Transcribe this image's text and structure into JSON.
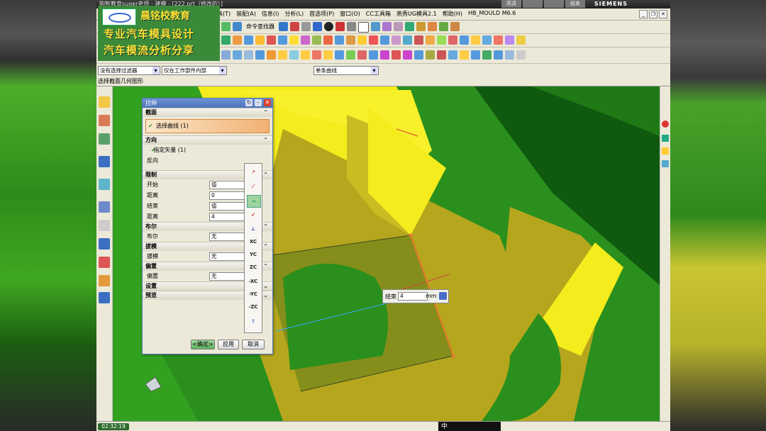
{
  "window": {
    "title": "购智教育suger老师 - 建模 - [222.prt（修改的）]",
    "brand": "SIEMENS",
    "window_buttons": [
      "高清",
      "",
      "",
      "结束"
    ]
  },
  "logo": {
    "line1": "晨铭校教育",
    "line2": "专业汽车模具设计",
    "line3": "汽车模流分析分享"
  },
  "menu": {
    "items": [
      "具(T)",
      "装配(A)",
      "信息(I)",
      "分析(L)",
      "首选项(P)",
      "窗口(O)",
      "CC工具箱",
      "燕秀UG模具2.1",
      "帮助(H)",
      "HB_MOULD M6.6"
    ],
    "find_command": "命令查找器"
  },
  "selection_bar": {
    "filter": "没有选择过滤器",
    "scope": "仅在工作部件内部",
    "curve_rule": "单条曲线"
  },
  "cue_line": "选择截面几何图形",
  "dialog": {
    "title": "拉伸",
    "sections": {
      "section": "截面",
      "direction": "方向",
      "limits": "限制",
      "boolean": "布尔",
      "draft": "拔模",
      "offset": "偏置",
      "settings": "设置",
      "preview": "预览"
    },
    "select_curve": "选择曲线 (1)",
    "specify_vector": "指定矢量 (1)",
    "reverse": "反向",
    "limits": [
      {
        "label": "开始",
        "value": "值"
      },
      {
        "label": "距离",
        "value": "0"
      },
      {
        "label": "结束",
        "value": "值"
      },
      {
        "label": "距离",
        "value": "4"
      }
    ],
    "boolean": {
      "label": "布尔",
      "value": "无"
    },
    "draft": {
      "label": "拔模",
      "value": "无"
    },
    "offset": {
      "label": "偏置",
      "value": "无"
    },
    "buttons": {
      "ok": "<确定>",
      "apply": "应用",
      "cancel": "取消"
    }
  },
  "vector_popup": [
    "XC",
    "YC",
    "ZC",
    "-XC",
    "-YC",
    "-ZC"
  ],
  "end_tip": {
    "label": "结束",
    "value": "4",
    "unit": "mm"
  },
  "status": {
    "clock": "02:32:19",
    "ime": "中"
  },
  "colors": {
    "viewport_green": "#2a8f1c",
    "dark_green": "#0f5a0f",
    "olive": "#b5a61e",
    "yellow": "#f4ec1c",
    "edge_orange": "#e6782a",
    "dialog_header": "#4d74b9"
  }
}
